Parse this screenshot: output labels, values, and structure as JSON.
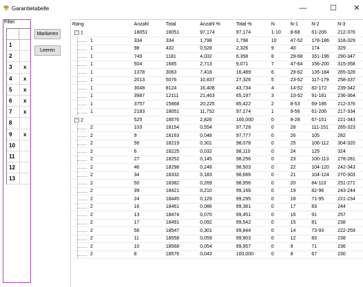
{
  "window": {
    "title": "Garantietabelle",
    "minimize_glyph": "—",
    "maximize_glyph": "☐",
    "close_glyph": "✕"
  },
  "filter": {
    "label": "Filter",
    "rows": [
      {
        "num": "1",
        "mark": ""
      },
      {
        "num": "2",
        "mark": ""
      },
      {
        "num": "3",
        "mark": "x"
      },
      {
        "num": "4",
        "mark": "x"
      },
      {
        "num": "5",
        "mark": "x"
      },
      {
        "num": "6",
        "mark": "x"
      },
      {
        "num": "7",
        "mark": "x"
      },
      {
        "num": "8",
        "mark": ""
      },
      {
        "num": "9",
        "mark": "x"
      },
      {
        "num": "10",
        "mark": ""
      },
      {
        "num": "11",
        "mark": ""
      },
      {
        "num": "12",
        "mark": ""
      },
      {
        "num": "13",
        "mark": ""
      }
    ]
  },
  "buttons": {
    "markieren": "Markieren",
    "leeren": "Leeren"
  },
  "table": {
    "columns": [
      "Rang",
      "Anzahl",
      "Total",
      "Anzahl %",
      "Total %",
      "N",
      "N-1",
      "N-2",
      "N-3"
    ],
    "rows": [
      {
        "level": 0,
        "expander": "−",
        "cells": [
          "1",
          "18051",
          "18051",
          "97,174",
          "97,174",
          "1-10",
          "8-68",
          "61-206",
          "212-376"
        ]
      },
      {
        "level": 1,
        "cells": [
          "1",
          "334",
          "334",
          "1,798",
          "1,798",
          "10",
          "47-52",
          "178-186",
          "318-329"
        ]
      },
      {
        "level": 1,
        "cells": [
          "1",
          "98",
          "432",
          "0,528",
          "2,326",
          "9",
          "40",
          "174",
          "329"
        ]
      },
      {
        "level": 1,
        "cells": [
          "1",
          "749",
          "1181",
          "4,032",
          "6,358",
          "8",
          "29-68",
          "161-196",
          "290-347"
        ]
      },
      {
        "level": 1,
        "cells": [
          "1",
          "504",
          "1685",
          "2,713",
          "9,071",
          "7",
          "47-64",
          "156-200",
          "315-358"
        ]
      },
      {
        "level": 1,
        "cells": [
          "1",
          "1378",
          "3063",
          "7,418",
          "16,489",
          "6",
          "29-62",
          "135-184",
          "265-328"
        ]
      },
      {
        "level": 1,
        "cells": [
          "1",
          "2013",
          "5076",
          "10,837",
          "27,326",
          "5",
          "23-52",
          "117-179",
          "258-337"
        ]
      },
      {
        "level": 1,
        "cells": [
          "1",
          "3048",
          "8124",
          "16,408",
          "43,734",
          "4",
          "14-52",
          "82-172",
          "239-342"
        ]
      },
      {
        "level": 1,
        "cells": [
          "1",
          "3987",
          "12111",
          "21,463",
          "65,197",
          "3",
          "10-52",
          "91-181",
          "236-364"
        ]
      },
      {
        "level": 1,
        "cells": [
          "1",
          "3757",
          "15868",
          "20,225",
          "85,422",
          "2",
          "8-53",
          "69-186",
          "212-376"
        ]
      },
      {
        "level": 1,
        "cells": [
          "1",
          "2183",
          "18051",
          "11,752",
          "97,174",
          "1",
          "9-56",
          "61-206",
          "217-334"
        ]
      },
      {
        "level": 0,
        "expander": "−",
        "cells": [
          "2",
          "525",
          "18576",
          "2,826",
          "100,000",
          "0",
          "8-28",
          "67-151",
          "221-343"
        ]
      },
      {
        "level": 1,
        "cells": [
          "2",
          "103",
          "18154",
          "0,554",
          "97,728",
          "0",
          "28",
          "111-151",
          "265-323"
        ]
      },
      {
        "level": 1,
        "cells": [
          "2",
          "9",
          "18163",
          "0,048",
          "97,777",
          "0",
          "26",
          "105",
          "282"
        ]
      },
      {
        "level": 1,
        "cells": [
          "2",
          "56",
          "18219",
          "0,301",
          "98,078",
          "0",
          "25",
          "106-112",
          "304-320"
        ]
      },
      {
        "level": 1,
        "cells": [
          "2",
          "6",
          "18225",
          "0,032",
          "98,110",
          "0",
          "24",
          "129",
          "324"
        ]
      },
      {
        "level": 1,
        "cells": [
          "2",
          "27",
          "18252",
          "0,145",
          "98,256",
          "0",
          "23",
          "100-113",
          "278-281"
        ]
      },
      {
        "level": 1,
        "cells": [
          "2",
          "46",
          "18298",
          "0,248",
          "98,503",
          "0",
          "22",
          "104-120",
          "242-343"
        ]
      },
      {
        "level": 1,
        "cells": [
          "2",
          "34",
          "18332",
          "0,183",
          "98,686",
          "0",
          "21",
          "104-124",
          "270-303"
        ]
      },
      {
        "level": 1,
        "cells": [
          "2",
          "50",
          "18382",
          "0,269",
          "98,956",
          "0",
          "20",
          "84-110",
          "251-271"
        ]
      },
      {
        "level": 1,
        "cells": [
          "2",
          "39",
          "18421",
          "0,210",
          "99,166",
          "0",
          "19",
          "82-96",
          "243-244"
        ]
      },
      {
        "level": 1,
        "cells": [
          "2",
          "24",
          "18445",
          "0,129",
          "99,295",
          "0",
          "18",
          "71-95",
          "221-234"
        ]
      },
      {
        "level": 1,
        "cells": [
          "2",
          "16",
          "18461",
          "0,086",
          "99,381",
          "0",
          "17",
          "83",
          "244"
        ]
      },
      {
        "level": 1,
        "cells": [
          "2",
          "13",
          "18474",
          "0,070",
          "99,451",
          "0",
          "16",
          "91",
          "257"
        ]
      },
      {
        "level": 1,
        "cells": [
          "2",
          "17",
          "18491",
          "0,092",
          "99,542",
          "0",
          "15",
          "81",
          "238"
        ]
      },
      {
        "level": 1,
        "cells": [
          "2",
          "56",
          "18547",
          "0,301",
          "99,844",
          "0",
          "14",
          "73-93",
          "222-259"
        ]
      },
      {
        "level": 1,
        "cells": [
          "2",
          "11",
          "18558",
          "0,059",
          "99,903",
          "0",
          "12",
          "83",
          "238"
        ]
      },
      {
        "level": 1,
        "cells": [
          "2",
          "10",
          "18568",
          "0,054",
          "99,957",
          "0",
          "9",
          "71",
          "236"
        ]
      },
      {
        "level": 1,
        "cells": [
          "2",
          "8",
          "18576",
          "0,043",
          "100,000",
          "0",
          "8",
          "67",
          "230"
        ]
      }
    ]
  }
}
